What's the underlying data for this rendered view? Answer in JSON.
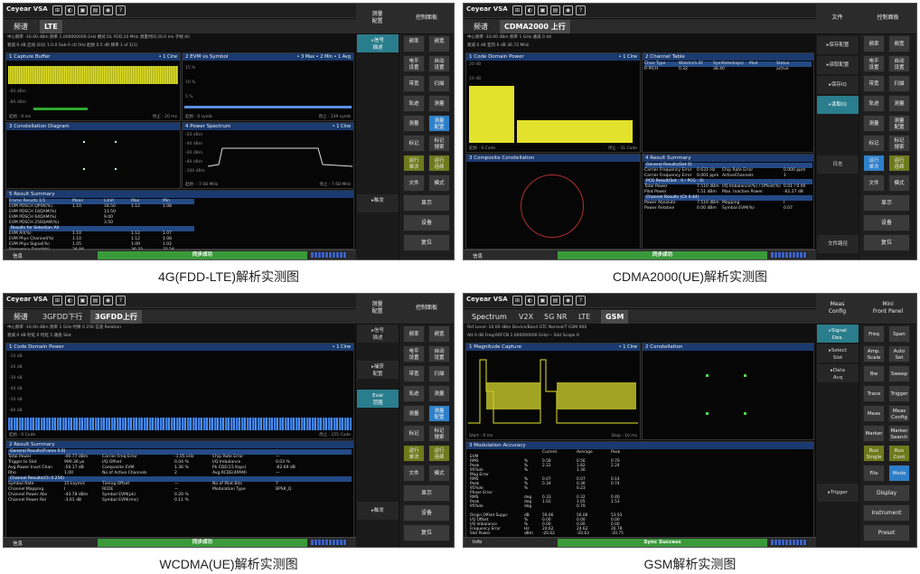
{
  "captions": [
    "4G(FDD-LTE)解析实测图",
    "CDMA2000(UE)解析实测图",
    "WCDMA(UE)解析实测图",
    "GSM解析实测图"
  ],
  "common": {
    "logo": "Ceyear VSA",
    "icons": [
      "window-icon",
      "bulb-icon",
      "save-icon",
      "print-icon",
      "camera-icon",
      "help-icon"
    ],
    "icon_glyphs": [
      "⊞",
      "◐",
      "▣",
      "▤",
      "◉",
      "?"
    ],
    "close": "X",
    "plus": "+"
  },
  "p1": {
    "tabs": [
      "频谱",
      "LTE"
    ],
    "info": [
      "中心频率  -10.00 dBm   频率 1.000000000 GHz     模式  DL FDD,10 MHz     测量时间  20.0 ms   子帧  All",
      "衰减  0 dB   启动 (EQ) 1.0.0 Sub-0 ctl 5Hz     起始  0.5 dB   频率 1 of 1(1)"
    ],
    "win1": {
      "title": "1 Capture Buffer",
      "tag": "• 1 Clrw",
      "yl": [
        "-20 dBm",
        "-40 dBm",
        "-60 dBm",
        "-80 dBm",
        "-100 dBm"
      ],
      "x0": "起始 : 0 ms",
      "x1": "停止 : 20 ms"
    },
    "win2": {
      "title": "2 EVM vs Symbol",
      "tag": "• 3 Max • 2 Min • 1 Avg",
      "yl": [
        "15 %",
        "10 %",
        "5 %"
      ],
      "x0": "起始 : 0 symb",
      "x1": "停止 : 139 symb"
    },
    "win3": {
      "title": "3 Constellation Diagram"
    },
    "win4": {
      "title": "4 Power Spectrum",
      "tag": "• 1 Clrw",
      "yl": [
        "-20 dBm",
        "-40 dBm",
        "-60 dBm",
        "-80 dBm",
        "-100 dBm"
      ],
      "x0": "起始 : -7.68 MHz",
      "x1": "停止 : 7.68 MHz"
    },
    "summary": {
      "title": "5 Result Summary",
      "header": [
        "Frame Results 1/1",
        "Mean",
        "Limit",
        "Max",
        "Min"
      ],
      "rows": [
        [
          "EVM PDSCH QPSK(%)",
          "1.10",
          "18.50",
          "1.12",
          "1.08"
        ],
        [
          "EVM PDSCH 16QAM(%)",
          "",
          "13.50",
          "",
          ""
        ],
        [
          "EVM PDSCH 64QAM(%)",
          "",
          "9.00",
          "",
          ""
        ],
        [
          "EVM PDSCH 256QAM(%)",
          "",
          "3.50",
          "",
          ""
        ]
      ],
      "sel": "Results for Selection   All",
      "rows2": [
        [
          "EVM All(%)",
          "1.10",
          "",
          "1.12",
          "1.07"
        ],
        [
          "EVM Phys Channel(%)",
          "1.10",
          "",
          "1.12",
          "1.08"
        ],
        [
          "EVM Phys Signal(%)",
          "1.05",
          "",
          "1.09",
          "1.02"
        ],
        [
          "Frequency Error(Hz)",
          "34.84",
          "",
          "36.33",
          "32.54"
        ],
        [
          "I/Q Offset(dB)",
          "-71.98",
          "",
          "-69.75",
          "-79.98"
        ]
      ]
    },
    "status": {
      "info": "信息",
      "center": "同步成功",
      "temp": "31.27℃",
      "time": "2023/03/21 04:22:17"
    },
    "rpanel": {
      "h1": "测量\n配置",
      "h2": "控制面板",
      "left": [
        "信号\n描述",
        "",
        "",
        "",
        "",
        "",
        "",
        "",
        "",
        "触发"
      ],
      "right": [
        [
          "频率",
          "频宽"
        ],
        [
          "电平\n设置",
          "自动\n设置"
        ],
        [
          "带宽",
          "扫描"
        ],
        [
          "轨迹",
          "测量"
        ],
        [
          "测量",
          "测量\n配置"
        ],
        [
          "标记",
          "标记\n搜索"
        ],
        [
          "运行\n单次",
          "运行\n连续"
        ],
        [
          "文件",
          "模式"
        ]
      ],
      "wide": [
        "显示",
        "设备",
        "复位"
      ]
    }
  },
  "p2": {
    "tabs": [
      "频谱",
      "CDMA2000 上行"
    ],
    "info": [
      "中心频率  -10.00 dBm   频率 1 GHz    通道  0 44",
      "衰减  0 dB    室内 0 dB  36.72 MHz"
    ],
    "win1": {
      "title": "1 Code Domain Power",
      "tag": "• 1 Clrw",
      "yl": [
        "20 dB",
        "10 dB",
        "0 dB",
        "-10 dB",
        "-20 dB",
        "-30 dB"
      ],
      "x0": "起始 : 0 Code",
      "x1": "停止 : 31 Code"
    },
    "table": {
      "title": "2 Channel Table",
      "header": [
        "Chan Type",
        "Walsh/ch.SF",
        "SymRate(ksps)",
        "Mod",
        "Status"
      ],
      "rows": [
        [
          "R-PICH",
          "0.32",
          "38.40",
          "",
          "active"
        ]
      ]
    },
    "win3": {
      "title": "3 Composite Constellation"
    },
    "summary": {
      "title": "4 Result Summary",
      "s1": "General Results(Set 0)",
      "r1": [
        [
          "Carrier Frequency Error",
          "0.631 Hz",
          "Chip Rate Error",
          "0.000 ppm"
        ],
        [
          "Carrier Frequency Error",
          "0.001 ppm",
          "ActiveChannels",
          "1"
        ]
      ],
      "s2": "PCG Result(Set : 0 / PCG : 0)",
      "r2": [
        [
          "Total Power",
          "7.510 dBm",
          "I/Q Imbalance(%) / Offset(%)",
          "0.01 / 0.00"
        ],
        [
          "Pilot Power",
          "7.51 dBm",
          "Max. Inactive Power",
          "-61.27 dB"
        ]
      ],
      "s3": "Channel Results (Ch 0.44)",
      "r3": [
        [
          "Power Absolute",
          "7.510 dBm",
          "Mapping",
          "I"
        ],
        [
          "Power Relative",
          "0.00 dBm",
          "Symbol EVM(%)",
          "0.07"
        ]
      ]
    },
    "status": {
      "info": "信息",
      "center": "同步成功",
      "temp": "42.43℃",
      "time": "2023/05/25 19:58:04"
    },
    "rpanel": {
      "h1": "文件",
      "h2": "控制面板",
      "left": [
        "保存配置",
        "读取配置",
        "保存IQ",
        "读取IQ",
        "",
        "",
        "日志",
        "",
        "",
        "文件路径"
      ],
      "right": [
        [
          "频率",
          "频宽"
        ],
        [
          "电平\n设置",
          "自动\n设置"
        ],
        [
          "带宽",
          "扫描"
        ],
        [
          "轨迹",
          "测量"
        ],
        [
          "测量",
          "测量\n配置"
        ],
        [
          "标记",
          "标记\n搜索"
        ],
        [
          "运行\n单次",
          "运行\n连续"
        ],
        [
          "文件",
          "模式"
        ]
      ],
      "wide": [
        "显示",
        "设备",
        "复位"
      ]
    }
  },
  "p3": {
    "tabs": [
      "频谱",
      "3GFDD下行",
      "3GFDD上行"
    ],
    "info": [
      "中心频率  -10.00 dBm   频率  1 GHz     时隙  0 256     信道  Relation",
      "衰减  0 dB     时延 0    时延  5     通道  Slot"
    ],
    "win1": {
      "title": "1 Code Domain Power",
      "tag": "• 1 Clrw",
      "yl": [
        "-10 dB",
        "-20 dB",
        "-30 dB",
        "-40 dB",
        "-50 dB",
        "-60 dB",
        "-70 dB"
      ],
      "x0": "起始 : 0 Code",
      "x1": "停止 : 255 Code"
    },
    "summary": {
      "title": "2 Result Summary",
      "s1": "General Results(Frame 0.0)",
      "r1": [
        [
          "Total Power",
          "-40.77 dBm",
          "Carrier Freq Error",
          "-1.05 kHz",
          "Chip Rate Error",
          "—"
        ],
        [
          "Trigger to Slot",
          "990.36 μs",
          "I/Q Offset",
          "0.04 %",
          "I/Q Imbalance",
          "0.03 %"
        ],
        [
          "Avg Power Inact Chan",
          "-50.17 dB",
          "Composite EVM",
          "1.36 %",
          "Pk CDE(15 Ksps)",
          "-62.69 dB"
        ],
        [
          "Rho",
          "1.00",
          "No of Active Channels",
          "2",
          "Avg RCDE(4PAM)",
          "—"
        ]
      ],
      "s2": "Channel Results(Ch 0.256)",
      "r2": [
        [
          "Symbol Rate",
          "15 ksym/s",
          "Timing Offset",
          "—",
          "No of Pilot Bits",
          "7"
        ],
        [
          "Channel Mapping",
          "I",
          "RCDE",
          "—",
          "Modulation Type",
          "BPSK_Q"
        ],
        [
          "Channel Power Abs",
          "-43.78 dBm",
          "Symbol EVM(pk)",
          "0.20 %",
          "",
          ""
        ],
        [
          "Channel Power Rel",
          "-3.01 dB",
          "Symbol EVM(rms)",
          "0.11 %",
          "",
          ""
        ]
      ]
    },
    "status": {
      "info": "信息",
      "center": "同步成功",
      "temp": "46.27℃",
      "time": "2023/03/20 15:00:14"
    },
    "rpanel": {
      "h1": "测量\n配置",
      "h2": "控制面板",
      "left": [
        "信号\n描述",
        "",
        "捕获\n配置",
        "",
        "Eval\n范围",
        "",
        "",
        "",
        "",
        "触发"
      ],
      "right": [
        [
          "频率",
          "频宽"
        ],
        [
          "电平\n设置",
          "自动\n设置"
        ],
        [
          "带宽",
          "扫描"
        ],
        [
          "轨迹",
          "测量"
        ],
        [
          "测量",
          "测量\n配置"
        ],
        [
          "标记",
          "标记\n搜索"
        ],
        [
          "运行\n单次",
          "运行\n连续"
        ],
        [
          "文件",
          "模式"
        ]
      ],
      "wide": [
        "显示",
        "设备",
        "复位"
      ]
    }
  },
  "p4": {
    "tabs": [
      "Spectrum",
      "V2X",
      "5G NR",
      "LTE",
      "GSM"
    ],
    "info": [
      "Ref Level  -10.00 dBm     Device/Band  GTC Normal/T  GSM 900",
      "Att  0 dB     Freq/ARFCN  1.000000000 GHz/—     Slot Scope  0"
    ],
    "win1": {
      "title": "1 Magnitude Capture",
      "tag": "• 1 Clrw",
      "x0": "Start : 0 ms",
      "x1": "Stop : 10 ms"
    },
    "win2": {
      "title": "2 Constellation"
    },
    "acc": {
      "title": "3 Modulation Accuracy",
      "header": [
        "",
        "",
        "Current",
        "Average",
        "Peak"
      ],
      "rows": [
        [
          "EVM",
          "",
          "",
          "",
          ""
        ],
        [
          "RMS",
          "%",
          "0.58",
          "0.56",
          "0.70"
        ],
        [
          "Peak",
          "%",
          "2.22",
          "1.82",
          "2.24"
        ],
        [
          "95%ile",
          "%",
          "",
          "1.30",
          ""
        ],
        [
          "Mag Error",
          "",
          "",
          "",
          ""
        ],
        [
          "RMS",
          "%",
          "0.07",
          "0.07",
          "0.14"
        ],
        [
          "Peak",
          "%",
          "0.34",
          "0.36",
          "0.74"
        ],
        [
          "95%ile",
          "%",
          "",
          "0.23",
          ""
        ],
        [
          "Phase Error",
          "",
          "",
          "",
          ""
        ],
        [
          "RMS",
          "deg",
          "0.33",
          "0.32",
          "0.40"
        ],
        [
          "Peak",
          "deg",
          "1.02",
          "1.05",
          "1.53"
        ],
        [
          "95%ile",
          "deg",
          "",
          "0.79",
          ""
        ],
        [
          "",
          "",
          "",
          "",
          ""
        ],
        [
          "Origin Offset Suppr.",
          "dB",
          "59.06",
          "56.06",
          "53.93"
        ],
        [
          "I/Q Offset",
          "%",
          "0.00",
          "0.00",
          "0.00"
        ],
        [
          "I/Q Imbalance",
          "%",
          "0.00",
          "0.00",
          "0.00"
        ],
        [
          "Frequency Error",
          "Hz",
          "24.62",
          "24.62",
          "26.78"
        ],
        [
          "Slot Power",
          "dBm",
          "-20.62",
          "-20.63",
          "-20.75"
        ]
      ]
    },
    "status": {
      "info": "Info",
      "center": "Sync Success",
      "temp": "30.6℃",
      "time": "2023/03/20 06:07:36"
    },
    "rpanel": {
      "h1": "Meas\nConfig",
      "h2": "Mini\nFront Panel",
      "left": [
        "Signal\nDes.",
        "Select\nSlot",
        "Data\nAcq",
        "",
        "",
        "",
        "",
        "",
        "Trigger",
        ""
      ],
      "right": [
        [
          "Freq",
          "Span"
        ],
        [
          "Amp.\nScale",
          "Auto\nSet"
        ],
        [
          "Bw",
          "Sweep"
        ],
        [
          "Trace",
          "Trigger"
        ],
        [
          "Meas",
          "Meas\nConfig"
        ],
        [
          "Marker",
          "Marker\nSearch"
        ],
        [
          "Run\nSingle",
          "Run\nCont"
        ],
        [
          "File",
          "Mode"
        ]
      ],
      "wide": [
        "Display",
        "Instrument",
        "Preset"
      ]
    }
  }
}
